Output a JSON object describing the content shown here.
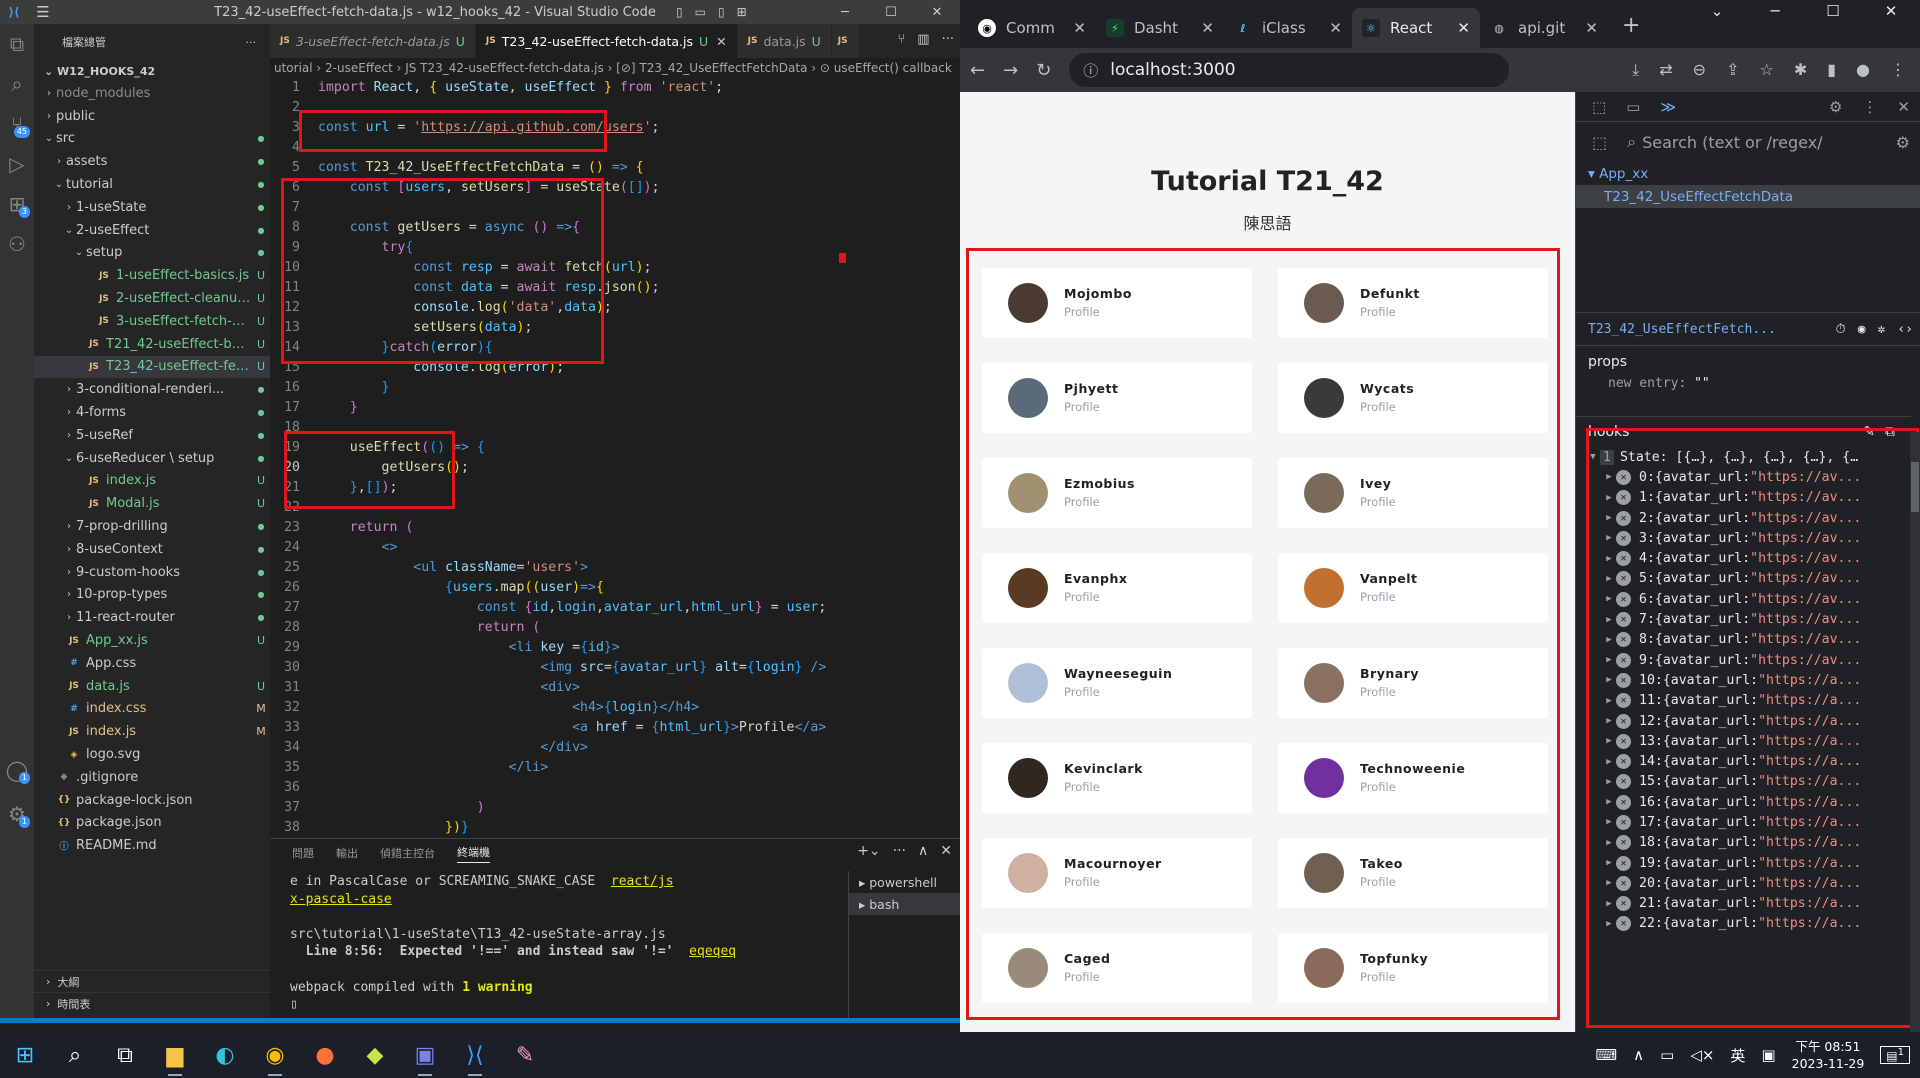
{
  "vscode": {
    "window_title": "T23_42-useEffect-fetch-data.js - w12_hooks_42 - Visual Studio Code",
    "explorer_title": "檔案總管",
    "project": "W12_HOOKS_42",
    "tree": [
      {
        "depth": 0,
        "chev": "›",
        "icon": "",
        "label": "node_modules",
        "status": "",
        "cls": "git"
      },
      {
        "depth": 0,
        "chev": "›",
        "icon": "",
        "label": "public",
        "status": "",
        "cls": ""
      },
      {
        "depth": 0,
        "chev": "⌄",
        "icon": "",
        "label": "src",
        "status": "●",
        "cls": ""
      },
      {
        "depth": 1,
        "chev": "›",
        "icon": "",
        "label": "assets",
        "status": "●",
        "cls": ""
      },
      {
        "depth": 1,
        "chev": "⌄",
        "icon": "",
        "label": "tutorial",
        "status": "●",
        "cls": ""
      },
      {
        "depth": 2,
        "chev": "›",
        "icon": "",
        "label": "1-useState",
        "status": "●",
        "cls": ""
      },
      {
        "depth": 2,
        "chev": "⌄",
        "icon": "",
        "label": "2-useEffect",
        "status": "●",
        "cls": ""
      },
      {
        "depth": 3,
        "chev": "⌄",
        "icon": "",
        "label": "setup",
        "status": "●",
        "cls": ""
      },
      {
        "depth": 4,
        "chev": "",
        "icon": "JS",
        "label": "1-useEffect-basics.js",
        "status": "U",
        "cls": ""
      },
      {
        "depth": 4,
        "chev": "",
        "icon": "JS",
        "label": "2-useEffect-cleanup....",
        "status": "U",
        "cls": ""
      },
      {
        "depth": 4,
        "chev": "",
        "icon": "JS",
        "label": "3-useEffect-fetch-d...",
        "status": "U",
        "cls": ""
      },
      {
        "depth": 3,
        "chev": "",
        "icon": "JS",
        "label": "T21_42-useEffect-bas...",
        "status": "U",
        "cls": ""
      },
      {
        "depth": 3,
        "chev": "",
        "icon": "JS",
        "label": "T23_42-useEffect-fet...",
        "status": "U",
        "cls": "sel"
      },
      {
        "depth": 2,
        "chev": "›",
        "icon": "",
        "label": "3-conditional-renderi...",
        "status": "●",
        "cls": ""
      },
      {
        "depth": 2,
        "chev": "›",
        "icon": "",
        "label": "4-forms",
        "status": "●",
        "cls": ""
      },
      {
        "depth": 2,
        "chev": "›",
        "icon": "",
        "label": "5-useRef",
        "status": "●",
        "cls": ""
      },
      {
        "depth": 2,
        "chev": "⌄",
        "icon": "",
        "label": "6-useReducer \\ setup",
        "status": "●",
        "cls": ""
      },
      {
        "depth": 3,
        "chev": "",
        "icon": "JS",
        "label": "index.js",
        "status": "U",
        "cls": ""
      },
      {
        "depth": 3,
        "chev": "",
        "icon": "JS",
        "label": "Modal.js",
        "status": "U",
        "cls": ""
      },
      {
        "depth": 2,
        "chev": "›",
        "icon": "",
        "label": "7-prop-drilling",
        "status": "●",
        "cls": ""
      },
      {
        "depth": 2,
        "chev": "›",
        "icon": "",
        "label": "8-useContext",
        "status": "●",
        "cls": ""
      },
      {
        "depth": 2,
        "chev": "›",
        "icon": "",
        "label": "9-custom-hooks",
        "status": "●",
        "cls": ""
      },
      {
        "depth": 2,
        "chev": "›",
        "icon": "",
        "label": "10-prop-types",
        "status": "●",
        "cls": ""
      },
      {
        "depth": 2,
        "chev": "›",
        "icon": "",
        "label": "11-react-router",
        "status": "●",
        "cls": ""
      },
      {
        "depth": 1,
        "chev": "",
        "icon": "JS",
        "label": "App_xx.js",
        "status": "U",
        "cls": ""
      },
      {
        "depth": 1,
        "chev": "",
        "icon": "#",
        "label": "App.css",
        "status": "",
        "cls": ""
      },
      {
        "depth": 1,
        "chev": "",
        "icon": "JS",
        "label": "data.js",
        "status": "U",
        "cls": ""
      },
      {
        "depth": 1,
        "chev": "",
        "icon": "#",
        "label": "index.css",
        "status": "M",
        "cls": ""
      },
      {
        "depth": 1,
        "chev": "",
        "icon": "JS",
        "label": "index.js",
        "status": "M",
        "cls": ""
      },
      {
        "depth": 1,
        "chev": "",
        "icon": "◈",
        "label": "logo.svg",
        "status": "",
        "cls": ""
      },
      {
        "depth": 0,
        "chev": "",
        "icon": "◆",
        "label": ".gitignore",
        "status": "",
        "cls": ""
      },
      {
        "depth": 0,
        "chev": "",
        "icon": "{}",
        "label": "package-lock.json",
        "status": "",
        "cls": ""
      },
      {
        "depth": 0,
        "chev": "",
        "icon": "{}",
        "label": "package.json",
        "status": "",
        "cls": ""
      },
      {
        "depth": 0,
        "chev": "",
        "icon": "ⓘ",
        "label": "README.md",
        "status": "",
        "cls": ""
      }
    ],
    "outline_label": "大綱",
    "timeline_label": "時間表",
    "tabs": [
      {
        "label": "3-useEffect-fetch-data.js",
        "status": "U",
        "active": false
      },
      {
        "label": "T23_42-useEffect-fetch-data.js",
        "status": "U",
        "active": true
      },
      {
        "label": "data.js",
        "status": "U",
        "active": false
      },
      {
        "label": "JS",
        "status": "",
        "active": false
      }
    ],
    "breadcrumb": "utorial › 2-useEffect › JS T23_42-useEffect-fetch-data.js › [⊘] T23_42_UseEffectFetchData › ⊙ useEffect() callback",
    "panel_tabs": [
      "問題",
      "輸出",
      "偵錯主控台",
      "終端機"
    ],
    "terminal_lines": {
      "l1a": "e in PascalCase or SCREAMING_SNAKE_CASE  ",
      "l1b": "react/js",
      "l2": "x-pascal-case",
      "l3": "src\\tutorial\\1-useState\\T13_42-useState-array.js",
      "l4a": "  Line 8:56:  Expected '!==' and instead saw '!='  ",
      "l4b": "eqeqeq",
      "l5a": "webpack compiled with ",
      "l5b": "1 warning",
      "l6": "▯"
    },
    "terminals": [
      "powershell",
      "bash"
    ]
  },
  "browser": {
    "tabs": [
      {
        "label": "Comm",
        "icon": "github-icon",
        "active": false
      },
      {
        "label": "Dasht",
        "icon": "dashboard-icon",
        "active": false
      },
      {
        "label": "iClass",
        "icon": "iclass-icon",
        "active": false
      },
      {
        "label": "React",
        "icon": "react-icon",
        "active": true
      },
      {
        "label": "api.git",
        "icon": "globe-icon",
        "active": false
      }
    ],
    "url": "localhost:3000",
    "page_title": "Tutorial T21_42",
    "page_subtitle": "陳思語",
    "profile_label": "Profile",
    "users": [
      {
        "login": "Mojombo",
        "color": "#4a3a30"
      },
      {
        "login": "Defunkt",
        "color": "#6b5a50"
      },
      {
        "login": "Pjhyett",
        "color": "#5a6a7a"
      },
      {
        "login": "Wycats",
        "color": "#3a3a3a"
      },
      {
        "login": "Ezmobius",
        "color": "#a09070"
      },
      {
        "login": "Ivey",
        "color": "#7a6a5a"
      },
      {
        "login": "Evanphx",
        "color": "#5a3a20"
      },
      {
        "login": "Vanpelt",
        "color": "#c07030"
      },
      {
        "login": "Wayneeseguin",
        "color": "#b0c0d8"
      },
      {
        "login": "Brynary",
        "color": "#8a7060"
      },
      {
        "login": "Kevinclark",
        "color": "#302820"
      },
      {
        "login": "Technoweenie",
        "color": "#7030a0"
      },
      {
        "login": "Macournoyer",
        "color": "#d0b0a0"
      },
      {
        "login": "Takeo",
        "color": "#706050"
      },
      {
        "login": "Caged",
        "color": "#9a8a7a"
      },
      {
        "login": "Topfunky",
        "color": "#8a6a5a"
      }
    ]
  },
  "devtools": {
    "search_placeholder": "Search (text or /regex/",
    "tree_root": "App_xx",
    "tree_child": "T23_42_UseEffectFetchData",
    "selected": "T23_42_UseEffectFetch...",
    "props_label": "props",
    "props_entry_key": "new entry:",
    "props_entry_val": "\"\"",
    "hooks_label": "hooks",
    "state_label": "State:",
    "state_preview": "[{…}, {…}, {…}, {…}, {…",
    "hook_prefix": "{avatar_url: ",
    "hook_value_short": "\"https://av...",
    "hook_value_long": "\"https://a...",
    "hook_count": 23
  },
  "taskbar": {
    "time": "下午 08:51",
    "date": "2023-11-29",
    "ime": "英",
    "notif": "1"
  }
}
